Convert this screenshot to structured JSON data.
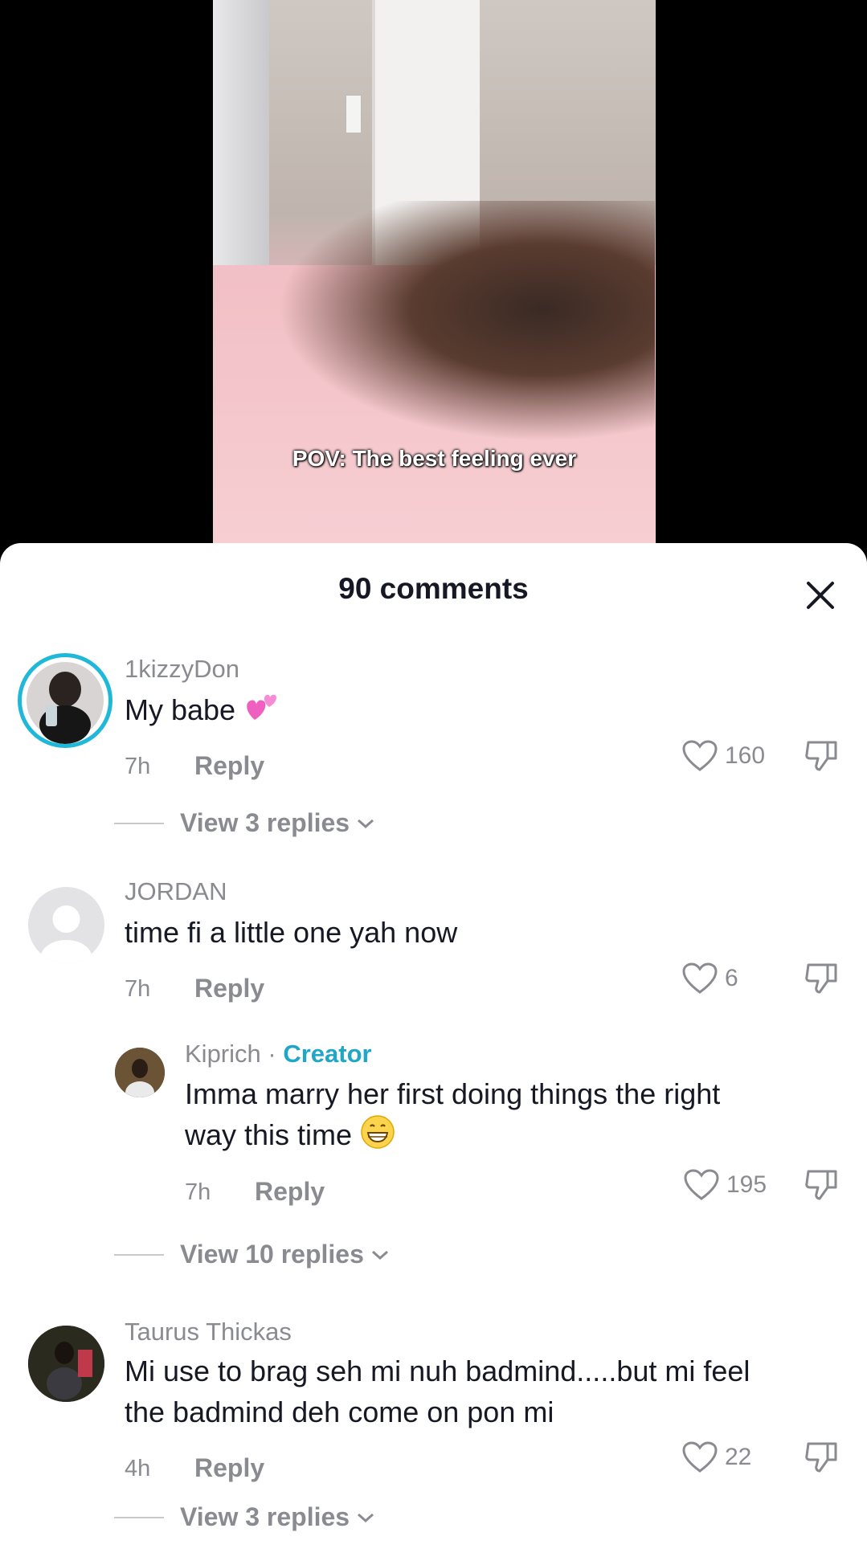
{
  "video": {
    "caption": "POV: The best feeling ever"
  },
  "sheet": {
    "title": "90 comments"
  },
  "comments": [
    {
      "username": "1kizzyDon",
      "text": "My babe",
      "emoji": "two-hearts",
      "time": "7h",
      "reply_label": "Reply",
      "likes": "160",
      "view_replies": "View 3 replies"
    },
    {
      "username": "JORDAN",
      "text": "time fi a little one yah now",
      "time": "7h",
      "reply_label": "Reply",
      "likes": "6"
    },
    {
      "username": "Kiprich",
      "separator": " · ",
      "creator_label": "Creator",
      "text_line1": "Imma marry her first doing things the right",
      "text_line2": "way this time",
      "emoji": "grinning-face",
      "time": "7h",
      "reply_label": "Reply",
      "likes": "195",
      "view_replies": "View 10 replies"
    },
    {
      "username": "Taurus Thickas",
      "text_line1": "Mi use to brag seh mi nuh badmind.....but mi feel",
      "text_line2": "the badmind deh come on pon mi",
      "time": "4h",
      "reply_label": "Reply",
      "likes": "22",
      "view_replies": "View 3 replies"
    }
  ],
  "colors": {
    "accent": "#20a6c6",
    "muted": "#8a8b91",
    "text": "#161823"
  }
}
